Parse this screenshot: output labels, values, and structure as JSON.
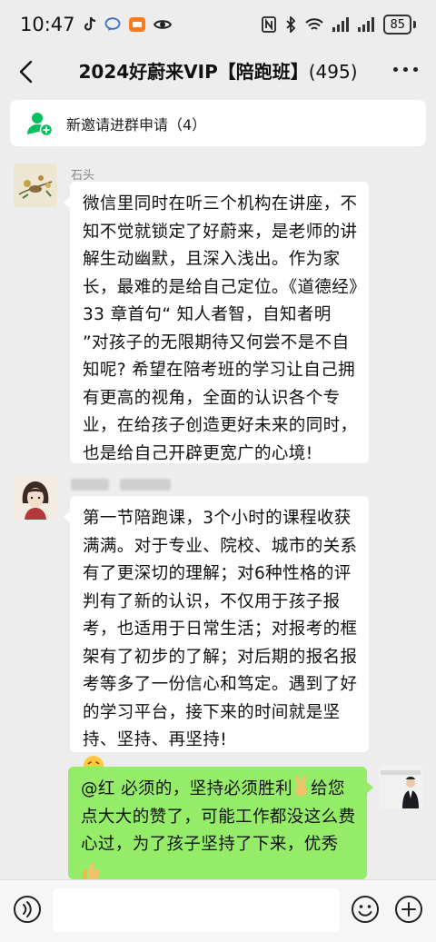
{
  "status_bar": {
    "time": "10:47",
    "battery": "85"
  },
  "header": {
    "title": "2024好蔚来VIP【陪跑班】",
    "member_count": "(495)"
  },
  "invite_banner": {
    "text": "新邀请进群申请（4）"
  },
  "messages": [
    {
      "sender": "石头",
      "side": "left",
      "text": "微信里同时在听三个机构在讲座，不知不觉就锁定了好蔚来，是老师的讲解生动幽默，且深入浅出。作为家长，最难的是给自己定位。《道德经》33 章首句“ 知人者智，自知者明 ”对孩子的无限期待又何尝不是不自知呢? 希望在陪考班的学习让自己拥有更高的视角，全面的认识各个专业，在给孩子创造更好未来的同时，也是给自己开辟更宽广的心境!"
    },
    {
      "sender": "",
      "side": "left",
      "text": "第一节陪跑课，3个小时的课程收获满满。对于专业、院校、城市的关系有了更深切的理解；对6种性格的评判有了新的认识，不仅用于孩子报考，也适用于日常生活；对报考的框架有了初步的了解；对后期的报名报考等多了一份信心和笃定。遇到了好的学习平台，接下来的时间就是坚持、坚持、再坚持!"
    },
    {
      "sender": "",
      "side": "right",
      "text_part1": "@红  必须的，坚持必须胜利",
      "text_part2": "给您点大大的赞了，可能工作都没这么费心过，为了孩子坚持了下来，优秀"
    }
  ],
  "icons": {
    "back": "back-arrow-icon",
    "more": "more-icon",
    "voice": "voice-icon",
    "emoji": "emoji-icon",
    "plus": "plus-icon"
  },
  "colors": {
    "my_bubble": "#95ec69",
    "accent": "#07c160"
  }
}
